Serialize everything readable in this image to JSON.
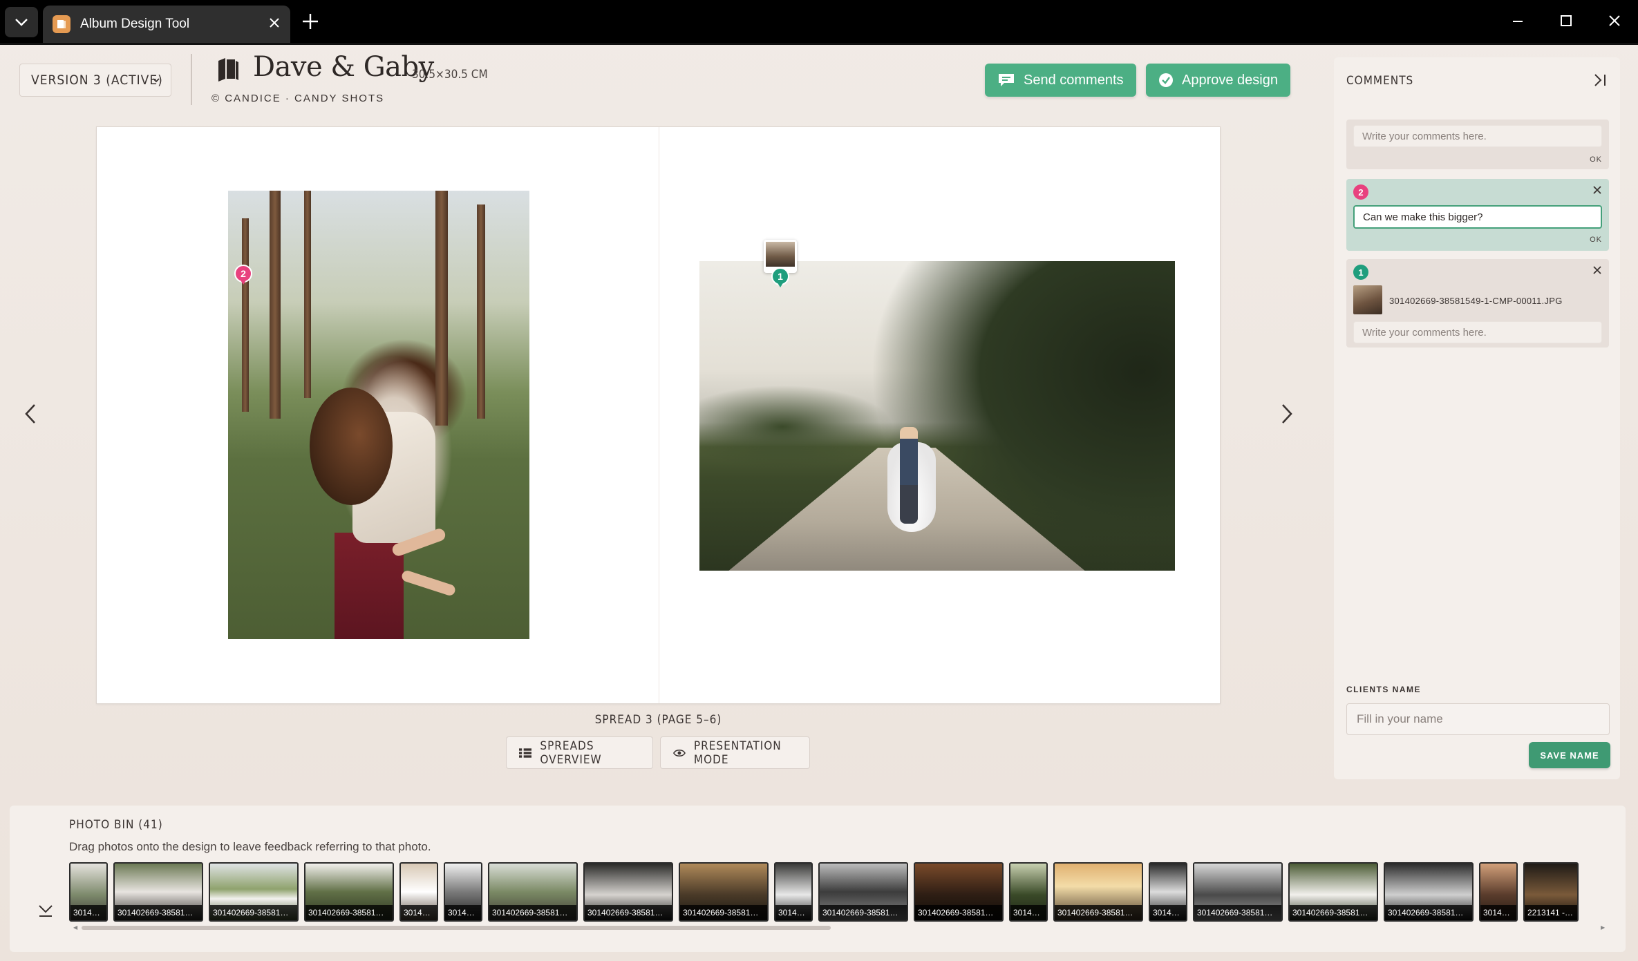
{
  "browser": {
    "tab_title": "Album Design Tool"
  },
  "header": {
    "version_label": "VERSION 3 (ACTIVE)",
    "album_title": "Dave & Gaby",
    "album_size": "30.5×30.5 CM",
    "credit": "© CANDICE · CANDY SHOTS",
    "send_comments_label": "Send comments",
    "approve_label": "Approve design"
  },
  "spread": {
    "label": "SPREAD 3 (PAGE 5–6)",
    "overview_label": "SPREADS OVERVIEW",
    "presentation_label": "PRESENTATION MODE",
    "pins": [
      {
        "number": "2",
        "color": "#e8417e"
      },
      {
        "number": "1",
        "color": "#1f9e7d"
      }
    ]
  },
  "comments": {
    "title": "COMMENTS",
    "new_comment_placeholder": "Write your comments here.",
    "ok_label": "OK",
    "items": [
      {
        "number": "2",
        "color": "#e8417e",
        "text": "Can we make this bigger?",
        "ok_label": "OK"
      },
      {
        "number": "1",
        "color": "#1f9e7d",
        "attachment": "301402669-38581549-1-CMP-00011.JPG",
        "placeholder": "Write your comments here."
      }
    ],
    "clients_name_label": "CLIENTS NAME",
    "clients_name_placeholder": "Fill in your name",
    "save_name_label": "SAVE NAME"
  },
  "photo_bin": {
    "title": "PHOTO BIN (41)",
    "subtitle": "Drag photos onto the design to leave feedback referring to that photo.",
    "thumbs": [
      {
        "caption": "30140…"
      },
      {
        "caption": "301402669-38581…"
      },
      {
        "caption": "301402669-38581…"
      },
      {
        "caption": "301402669-38581…"
      },
      {
        "caption": "30140…"
      },
      {
        "caption": "30140…"
      },
      {
        "caption": "301402669-38581…"
      },
      {
        "caption": "301402669-38581…"
      },
      {
        "caption": "301402669-38581…"
      },
      {
        "caption": "30140…"
      },
      {
        "caption": "301402669-38581…"
      },
      {
        "caption": "301402669-38581…"
      },
      {
        "caption": "30140…"
      },
      {
        "caption": "301402669-38581…"
      },
      {
        "caption": "30140…"
      },
      {
        "caption": "301402669-38581…"
      },
      {
        "caption": "301402669-38581…"
      },
      {
        "caption": "301402669-38581…"
      },
      {
        "caption": "30140…"
      },
      {
        "caption": "2213141 - 10"
      }
    ]
  },
  "colors": {
    "accent_green": "#4caf84",
    "pin_pink": "#e8417e",
    "pin_teal": "#1f9e7d"
  }
}
